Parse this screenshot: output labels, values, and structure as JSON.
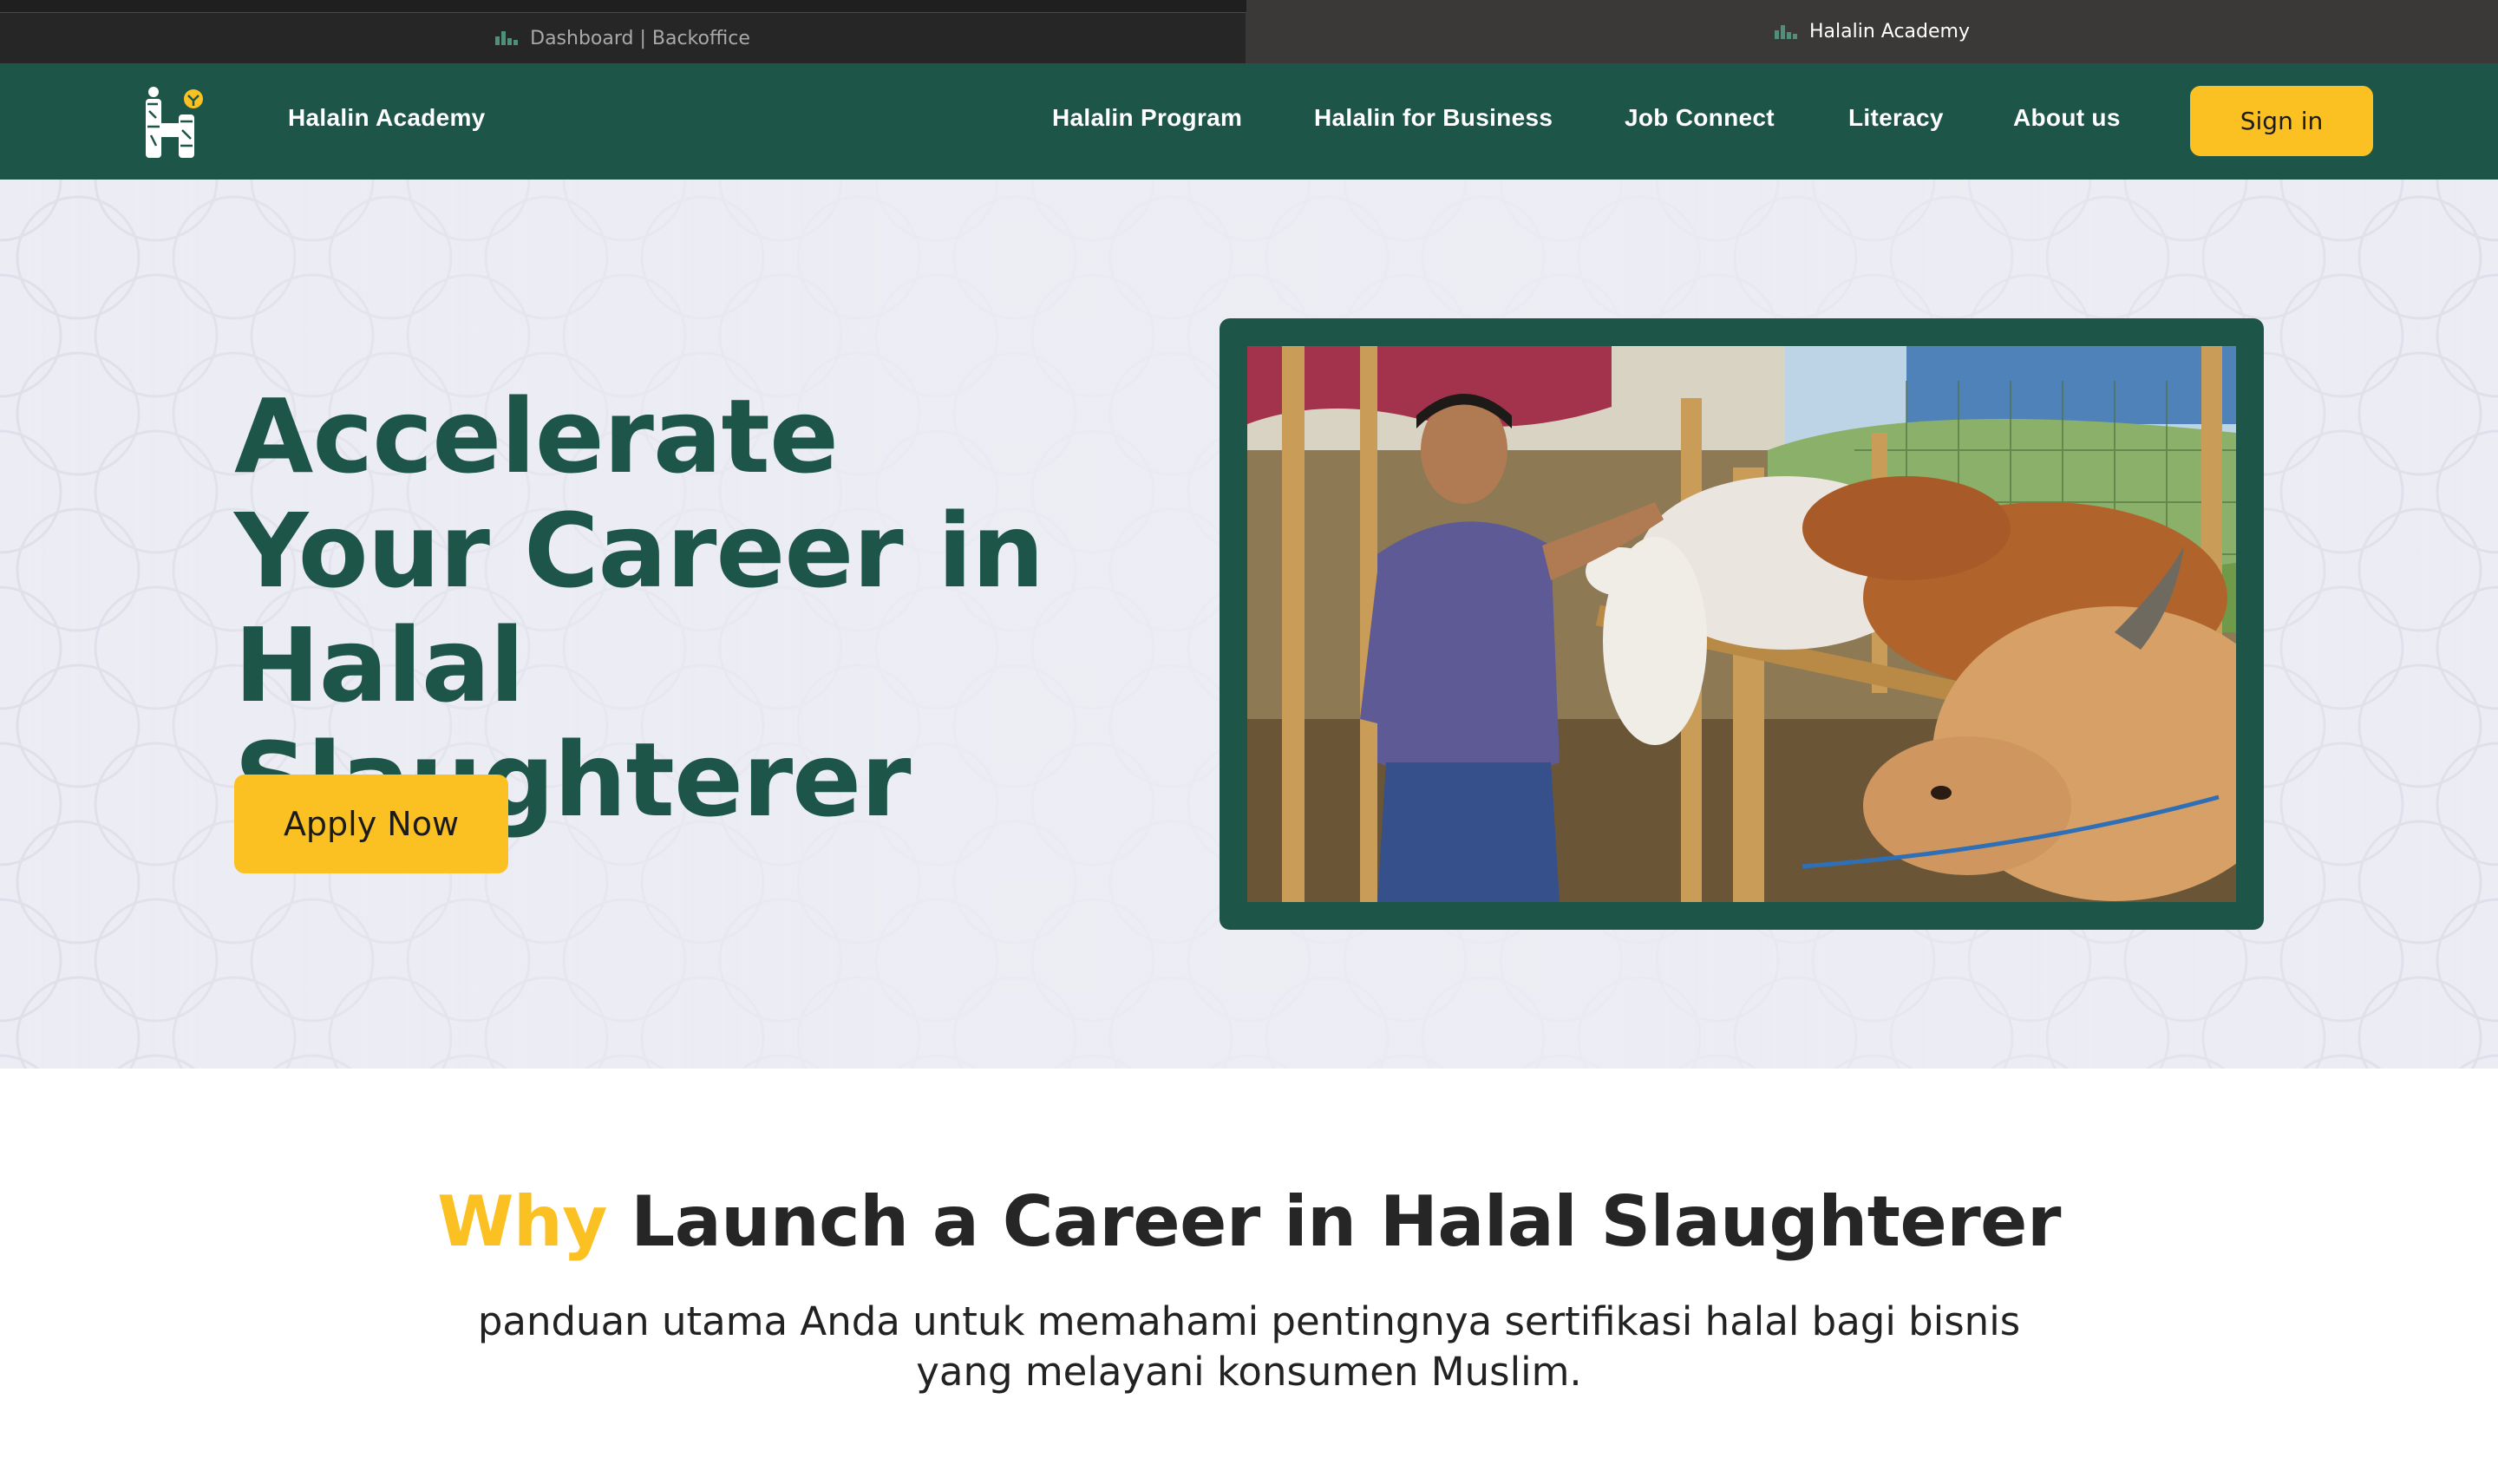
{
  "browser": {
    "tabs": [
      {
        "label": "Dashboard | Backoffice",
        "active": false
      },
      {
        "label": "Halalin Academy",
        "active": true
      }
    ]
  },
  "nav": {
    "brand": "Halalin Academy",
    "menu": [
      "Halalin Program",
      "Halalin for Business",
      "Job Connect",
      "Literacy",
      "About us"
    ],
    "signin": "Sign in"
  },
  "hero": {
    "title": "Accelerate Your Career in Halal Slaughterer",
    "cta": "Apply Now",
    "image": "man-with-cattle-photo"
  },
  "why": {
    "accent": "Why",
    "title_rest": " Launch a Career in Halal Slaughterer",
    "subtitle": "panduan utama Anda untuk memahami pentingnya sertifikasi halal bagi bisnis yang melayani konsumen Muslim."
  },
  "colors": {
    "primary": "#1d5548",
    "accent": "#fbc122",
    "hero_bg": "#ececf4"
  }
}
